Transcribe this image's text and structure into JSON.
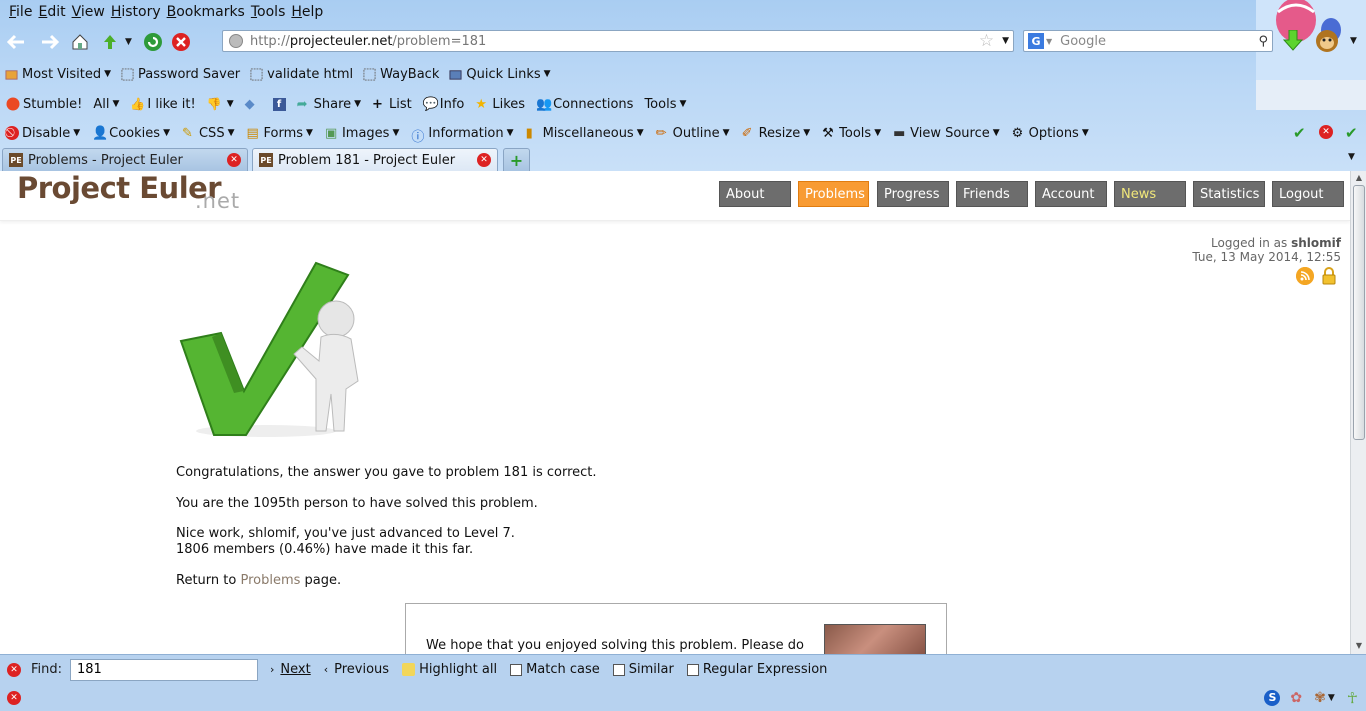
{
  "menubar": {
    "items": [
      "File",
      "Edit",
      "View",
      "History",
      "Bookmarks",
      "Tools",
      "Help"
    ]
  },
  "navbar": {
    "url_scheme": "http://",
    "url_host": "projecteuler.net",
    "url_path": "/problem=181",
    "search_placeholder": "Google"
  },
  "bookmarks": {
    "items": [
      "Most Visited",
      "Password Saver",
      "validate html",
      "WayBack",
      "Quick Links"
    ]
  },
  "stumblebar": {
    "stumble": "Stumble!",
    "all": "All",
    "like": "I like it!",
    "share": "Share",
    "list": "List",
    "info": "Info",
    "likes": "Likes",
    "connections": "Connections",
    "tools": "Tools"
  },
  "devbar": {
    "items": [
      "Disable",
      "Cookies",
      "CSS",
      "Forms",
      "Images",
      "Information",
      "Miscellaneous",
      "Outline",
      "Resize",
      "Tools",
      "View Source",
      "Options"
    ]
  },
  "tabs": [
    {
      "label": "Problems - Project Euler",
      "favicon": "PE"
    },
    {
      "label": "Problem 181 - Project Euler",
      "favicon": "PE"
    }
  ],
  "site": {
    "logo": "Project Euler",
    "logo_sub": ".net",
    "nav": [
      "About",
      "Problems",
      "Progress",
      "Friends",
      "Account",
      "News",
      "Statistics",
      "Logout"
    ],
    "login_prefix": "Logged in as",
    "username": "shlomif",
    "datetime": "Tue, 13 May 2014, 12:55"
  },
  "content": {
    "congrats": "Congratulations, the answer you gave to problem 181 is correct.",
    "rank": "You are the 1095th person to have solved this problem.",
    "level_line1": "Nice work, shlomif, you've just advanced to Level 7.",
    "level_line2": "1806 members (0.46%) have made it this far.",
    "return_prefix": "Return to",
    "return_link": "Problems",
    "return_suffix": "page.",
    "promo_text": "We hope that you enjoyed solving this problem. Please do"
  },
  "findbar": {
    "find_label": "Find:",
    "query": "181",
    "next": "Next",
    "previous": "Previous",
    "highlight_all": "Highlight all",
    "match_case": "Match case",
    "similar": "Similar",
    "regex": "Regular Expression"
  },
  "colors": {
    "accent_orange": "#f89b33",
    "nav_gray": "#6d6d6d",
    "logo_brown": "#6a4a33",
    "check_green": "#4caf2a"
  }
}
